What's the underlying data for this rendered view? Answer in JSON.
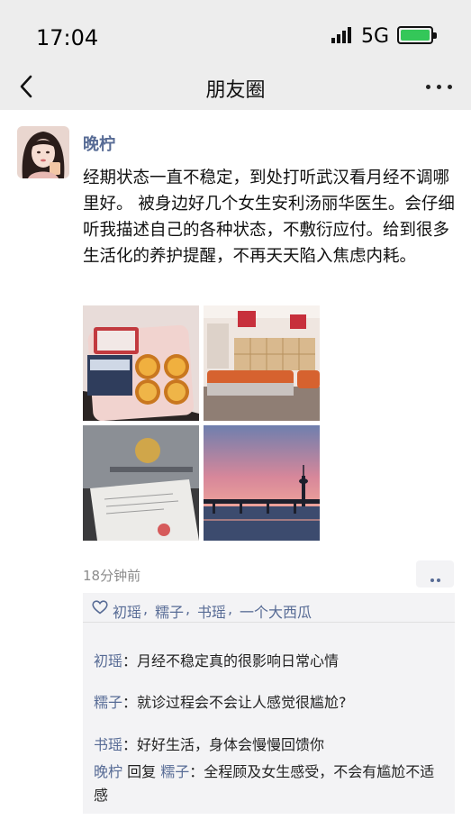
{
  "status_bar": {
    "time": "17:04",
    "network": "5G"
  },
  "nav": {
    "title": "朋友圈"
  },
  "post": {
    "username": "晚柠",
    "text": "经期状态一直不稳定，到处打听武汉看月经不调哪里好。 被身边好几个女生安利汤丽华医生。会仔细听我描述自己的各种状态，不敷衍应付。给到很多生活化的养护提醒，不再天天陷入焦虑内耗。",
    "timestamp": "18分钟前"
  },
  "likes": [
    "初瑶",
    "糯子",
    "书瑶",
    "一个大西瓜"
  ],
  "comments": [
    {
      "author": "初瑶",
      "sep": "：",
      "text": "月经不稳定真的很影响日常心情"
    },
    {
      "author": "糯子",
      "sep": "：",
      "text": "就诊过程会不会让人感觉很尴尬?"
    },
    {
      "author": "书瑶",
      "sep": "：",
      "text": "好好生活，身体会慢慢回馈你"
    },
    {
      "author": "晚柠",
      "reply_word": " 回复 ",
      "reply_to": "糯子",
      "sep": "：",
      "text": "全程顾及女生感受，不会有尴尬不适感"
    }
  ],
  "icons": {
    "back": "chevron-left-icon",
    "more": "more-dots-icon",
    "like": "heart-outline-icon",
    "action": "two-dots-icon"
  },
  "colors": {
    "link_blue": "#576b95",
    "header_bg": "#ededed",
    "comment_bg": "#f3f3f5",
    "battery_green": "#34c759"
  }
}
